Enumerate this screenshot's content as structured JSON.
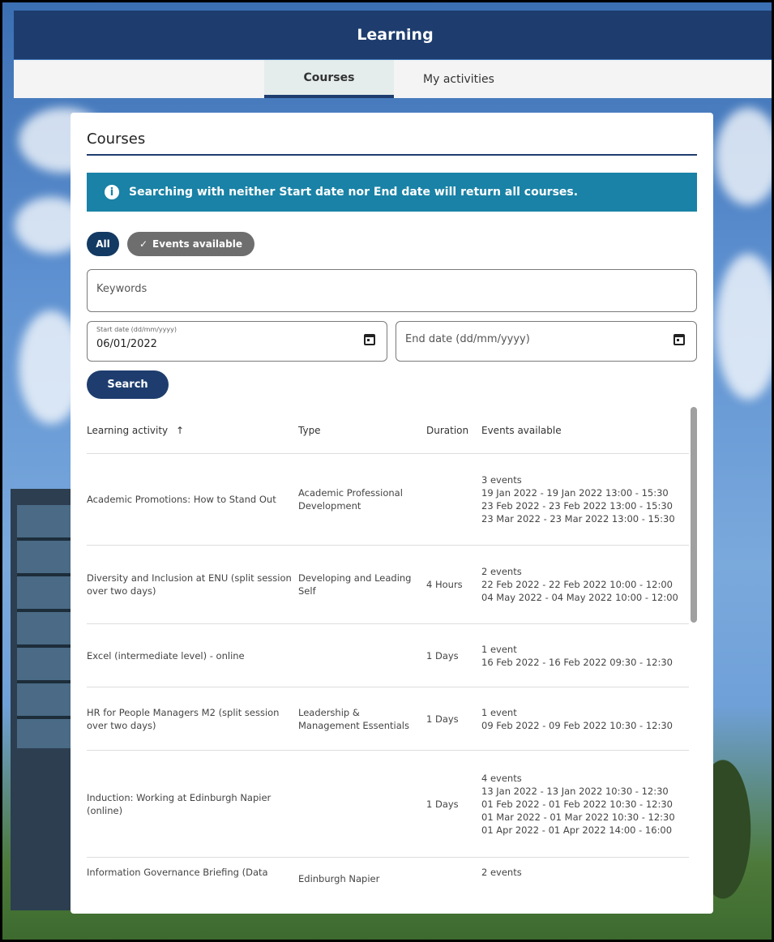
{
  "header": {
    "title": "Learning"
  },
  "tabs": [
    {
      "label": "Courses",
      "active": true
    },
    {
      "label": "My activities",
      "active": false
    }
  ],
  "card": {
    "title": "Courses",
    "info_message": "Searching with neither Start date nor End date will return all courses."
  },
  "filters": {
    "all_label": "All",
    "events_label": "Events available"
  },
  "form": {
    "keywords_placeholder": "Keywords",
    "start_label": "Start date (dd/mm/yyyy)",
    "start_value": "06/01/2022",
    "end_placeholder": "End date (dd/mm/yyyy)",
    "search_label": "Search"
  },
  "table": {
    "headers": {
      "activity": "Learning activity",
      "sort_arrow": "↑",
      "type": "Type",
      "duration": "Duration",
      "events": "Events available"
    },
    "rows": [
      {
        "activity": "Academic Promotions: How to Stand Out",
        "type": "Academic Professional Development",
        "duration": "",
        "events": [
          "3 events",
          "19 Jan 2022 - 19 Jan 2022 13:00 - 15:30",
          "23 Feb 2022 - 23 Feb 2022 13:00 - 15:30",
          "23 Mar 2022 - 23 Mar 2022 13:00 - 15:30"
        ]
      },
      {
        "activity": "Diversity and Inclusion at ENU (split session over two days)",
        "type": "Developing and Leading Self",
        "duration": "4 Hours",
        "events": [
          "2 events",
          "22 Feb 2022 - 22 Feb 2022 10:00 - 12:00",
          "04 May 2022 - 04 May 2022 10:00 - 12:00"
        ]
      },
      {
        "activity": "Excel (intermediate level) - online",
        "type": "",
        "duration": "1 Days",
        "events": [
          "1 event",
          "16 Feb 2022 - 16 Feb 2022 09:30 - 12:30"
        ]
      },
      {
        "activity": "HR for People Managers M2 (split session over two days)",
        "type": "Leadership & Management Essentials",
        "duration": "1 Days",
        "events": [
          "1 event",
          "09 Feb 2022 - 09 Feb 2022 10:30 - 12:30"
        ]
      },
      {
        "activity": "Induction: Working at Edinburgh Napier (online)",
        "type": "",
        "duration": "1 Days",
        "events": [
          "4 events",
          "13 Jan 2022 - 13 Jan 2022 10:30 - 12:30",
          "01 Feb 2022 - 01 Feb 2022 10:30 - 12:30",
          "01 Mar 2022 - 01 Mar 2022 10:30 - 12:30",
          "01 Apr 2022 - 01 Apr 2022 14:00 - 16:00"
        ]
      },
      {
        "activity": "Information Governance Briefing (Data",
        "type": "Edinburgh Napier",
        "duration": "",
        "events": [
          "2 events"
        ]
      }
    ]
  }
}
